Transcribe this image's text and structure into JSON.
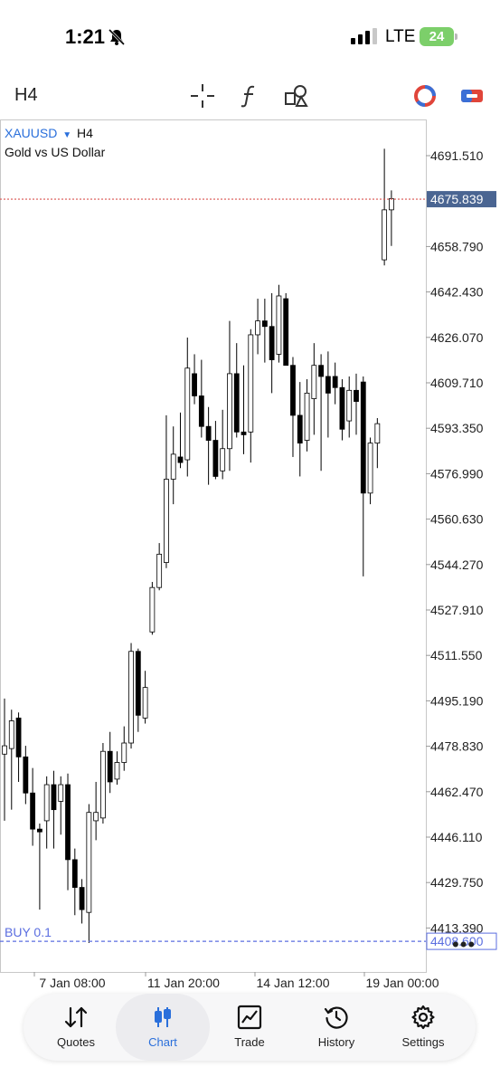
{
  "status_bar": {
    "time": "1:21",
    "network": "LTE",
    "battery": "24"
  },
  "toolbar": {
    "timeframe": "H4",
    "icons": [
      "crosshair-icon",
      "function-icon",
      "objects-icon",
      "market-watch-icon",
      "trade-panel-icon"
    ]
  },
  "chart": {
    "symbol": "XAUUSD",
    "timeframe": "H4",
    "description": "Gold vs US Dollar",
    "current_price": "4675.839",
    "buy_order": {
      "label": "BUY 0.1",
      "price": "4408.600"
    },
    "price_labels": [
      "4691.510",
      "4658.790",
      "4642.430",
      "4626.070",
      "4609.710",
      "4593.350",
      "4576.990",
      "4560.630",
      "4544.270",
      "4527.910",
      "4511.550",
      "4495.190",
      "4478.830",
      "4462.470",
      "4446.110",
      "4429.750",
      "4413.390"
    ],
    "time_labels": [
      "7 Jan 08:00",
      "11 Jan 20:00",
      "14 Jan 12:00",
      "19 Jan 00:00"
    ],
    "colors": {
      "up_candle": "#ffffff",
      "down_candle": "#000000",
      "price_line": "#d9534f",
      "price_tag": "#4a6592",
      "buy_line": "#5b6ee0",
      "accent": "#2a6fdb"
    }
  },
  "chart_data": {
    "type": "candlestick",
    "ylim": [
      4406,
      4710
    ],
    "series": [
      {
        "x": 0,
        "open": 4476,
        "high": 4496,
        "low": 4452,
        "close": 4479
      },
      {
        "x": 1,
        "open": 4478,
        "high": 4492,
        "low": 4456,
        "close": 4488
      },
      {
        "x": 2,
        "open": 4489,
        "high": 4491,
        "low": 4466,
        "close": 4475
      },
      {
        "x": 3,
        "open": 4475,
        "high": 4479,
        "low": 4458,
        "close": 4462
      },
      {
        "x": 4,
        "open": 4462,
        "high": 4471,
        "low": 4443,
        "close": 4449
      },
      {
        "x": 5,
        "open": 4449,
        "high": 4451,
        "low": 4420,
        "close": 4448
      },
      {
        "x": 6,
        "open": 4452,
        "high": 4468,
        "low": 4442,
        "close": 4465
      },
      {
        "x": 7,
        "open": 4465,
        "high": 4470,
        "low": 4442,
        "close": 4456
      },
      {
        "x": 8,
        "open": 4459,
        "high": 4468,
        "low": 4447,
        "close": 4465
      },
      {
        "x": 9,
        "open": 4465,
        "high": 4469,
        "low": 4427,
        "close": 4438
      },
      {
        "x": 10,
        "open": 4438,
        "high": 4442,
        "low": 4418,
        "close": 4428
      },
      {
        "x": 11,
        "open": 4428,
        "high": 4431,
        "low": 4415,
        "close": 4420
      },
      {
        "x": 12,
        "open": 4419,
        "high": 4458,
        "low": 4408,
        "close": 4455
      },
      {
        "x": 13,
        "open": 4452,
        "high": 4466,
        "low": 4445,
        "close": 4455
      },
      {
        "x": 14,
        "open": 4453,
        "high": 4480,
        "low": 4451,
        "close": 4477
      },
      {
        "x": 15,
        "open": 4477,
        "high": 4484,
        "low": 4462,
        "close": 4466
      },
      {
        "x": 16,
        "open": 4467,
        "high": 4477,
        "low": 4465,
        "close": 4473
      },
      {
        "x": 17,
        "open": 4473,
        "high": 4486,
        "low": 4470,
        "close": 4480
      },
      {
        "x": 18,
        "open": 4480,
        "high": 4516,
        "low": 4478,
        "close": 4513
      },
      {
        "x": 19,
        "open": 4513,
        "high": 4514,
        "low": 4484,
        "close": 4490
      },
      {
        "x": 20,
        "open": 4489,
        "high": 4506,
        "low": 4487,
        "close": 4500
      },
      {
        "x": 21,
        "open": 4520,
        "high": 4538,
        "low": 4519,
        "close": 4536
      },
      {
        "x": 22,
        "open": 4536,
        "high": 4552,
        "low": 4535,
        "close": 4548
      },
      {
        "x": 23,
        "open": 4545,
        "high": 4598,
        "low": 4543,
        "close": 4575
      },
      {
        "x": 24,
        "open": 4575,
        "high": 4594,
        "low": 4566,
        "close": 4584
      },
      {
        "x": 25,
        "open": 4583,
        "high": 4599,
        "low": 4579,
        "close": 4581
      },
      {
        "x": 26,
        "open": 4582,
        "high": 4626,
        "low": 4576,
        "close": 4615
      },
      {
        "x": 27,
        "open": 4613,
        "high": 4620,
        "low": 4602,
        "close": 4605
      },
      {
        "x": 28,
        "open": 4605,
        "high": 4618,
        "low": 4590,
        "close": 4594
      },
      {
        "x": 29,
        "open": 4594,
        "high": 4601,
        "low": 4573,
        "close": 4589
      },
      {
        "x": 30,
        "open": 4589,
        "high": 4596,
        "low": 4575,
        "close": 4576
      },
      {
        "x": 31,
        "open": 4578,
        "high": 4600,
        "low": 4575,
        "close": 4586
      },
      {
        "x": 32,
        "open": 4586,
        "high": 4632,
        "low": 4578,
        "close": 4613
      },
      {
        "x": 33,
        "open": 4613,
        "high": 4624,
        "low": 4590,
        "close": 4592
      },
      {
        "x": 34,
        "open": 4592,
        "high": 4616,
        "low": 4584,
        "close": 4591
      },
      {
        "x": 35,
        "open": 4592,
        "high": 4629,
        "low": 4581,
        "close": 4627
      },
      {
        "x": 36,
        "open": 4627,
        "high": 4640,
        "low": 4620,
        "close": 4632
      },
      {
        "x": 37,
        "open": 4632,
        "high": 4640,
        "low": 4617,
        "close": 4630
      },
      {
        "x": 38,
        "open": 4630,
        "high": 4642,
        "low": 4606,
        "close": 4618
      },
      {
        "x": 39,
        "open": 4620,
        "high": 4645,
        "low": 4617,
        "close": 4641
      },
      {
        "x": 40,
        "open": 4640,
        "high": 4642,
        "low": 4616,
        "close": 4616
      },
      {
        "x": 41,
        "open": 4616,
        "high": 4619,
        "low": 4583,
        "close": 4598
      },
      {
        "x": 42,
        "open": 4598,
        "high": 4610,
        "low": 4576,
        "close": 4588
      },
      {
        "x": 43,
        "open": 4589,
        "high": 4611,
        "low": 4585,
        "close": 4606
      },
      {
        "x": 44,
        "open": 4604,
        "high": 4624,
        "low": 4591,
        "close": 4616
      },
      {
        "x": 45,
        "open": 4616,
        "high": 4620,
        "low": 4578,
        "close": 4612
      },
      {
        "x": 46,
        "open": 4612,
        "high": 4621,
        "low": 4590,
        "close": 4606
      },
      {
        "x": 47,
        "open": 4612,
        "high": 4617,
        "low": 4602,
        "close": 4608
      },
      {
        "x": 48,
        "open": 4608,
        "high": 4611,
        "low": 4589,
        "close": 4593
      },
      {
        "x": 49,
        "open": 4596,
        "high": 4612,
        "low": 4590,
        "close": 4607
      },
      {
        "x": 50,
        "open": 4607,
        "high": 4613,
        "low": 4591,
        "close": 4603
      },
      {
        "x": 51,
        "open": 4610,
        "high": 4612,
        "low": 4540,
        "close": 4570
      },
      {
        "x": 52,
        "open": 4570,
        "high": 4590,
        "low": 4566,
        "close": 4588
      },
      {
        "x": 53,
        "open": 4588,
        "high": 4597,
        "low": 4579,
        "close": 4595
      },
      {
        "x": 54,
        "open": 4654,
        "high": 4694,
        "low": 4652,
        "close": 4672
      },
      {
        "x": 55,
        "open": 4672,
        "high": 4679,
        "low": 4659,
        "close": 4676
      }
    ]
  },
  "bottom_nav": [
    {
      "label": "Quotes",
      "icon": "quotes-arrows-icon"
    },
    {
      "label": "Chart",
      "icon": "candles-icon"
    },
    {
      "label": "Trade",
      "icon": "trade-chart-icon"
    },
    {
      "label": "History",
      "icon": "history-clock-icon"
    },
    {
      "label": "Settings",
      "icon": "gear-icon"
    }
  ]
}
